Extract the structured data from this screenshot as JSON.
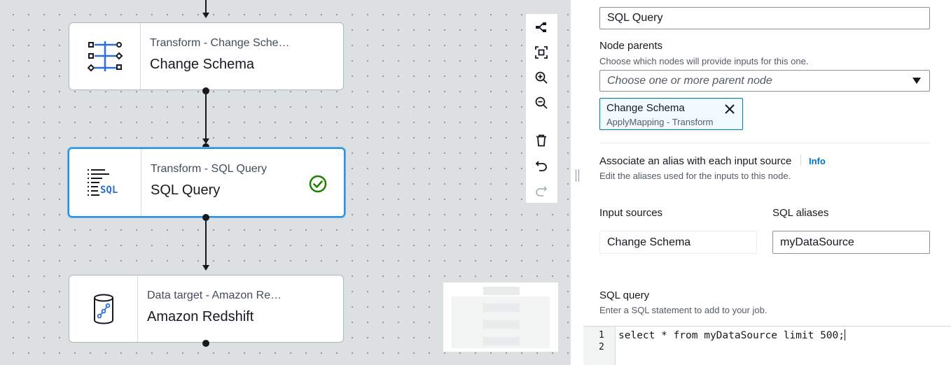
{
  "canvas": {
    "nodes": [
      {
        "type": "Transform - Change Sche…",
        "title": "Change Schema",
        "icon": "change-schema-icon",
        "selected": false
      },
      {
        "type": "Transform - SQL Query",
        "title": "SQL Query",
        "icon": "sql-query-icon",
        "selected": true,
        "status": "success-check-icon"
      },
      {
        "type": "Data target - Amazon Re…",
        "title": "Amazon Redshift",
        "icon": "redshift-icon",
        "selected": false
      }
    ],
    "icon_text": {
      "sql": "SQL"
    },
    "toolbar": [
      "layout-icon",
      "fit-to-screen-icon",
      "zoom-in-icon",
      "zoom-out-icon",
      "delete-icon",
      "undo-icon",
      "redo-icon"
    ]
  },
  "panel": {
    "name_value": "SQL Query",
    "node_parents": {
      "label": "Node parents",
      "description": "Choose which nodes will provide inputs for this one.",
      "placeholder": "Choose one or more parent node",
      "token": {
        "title": "Change Schema",
        "subtitle": "ApplyMapping - Transform"
      }
    },
    "alias": {
      "label": "Associate an alias with each input source",
      "info": "Info",
      "description": "Edit the aliases used for the inputs to this node."
    },
    "input_sources": {
      "label": "Input sources",
      "value": "Change Schema"
    },
    "sql_aliases": {
      "label": "SQL aliases",
      "value": "myDataSource"
    },
    "sql_query": {
      "label": "SQL query",
      "description": "Enter a SQL statement to add to your job.",
      "lines": [
        "1",
        "2"
      ],
      "code": "select * from myDataSource limit 500;"
    }
  },
  "colors": {
    "selected_border": "#2a93e0",
    "success": "#1d8102",
    "link": "#0073bb",
    "icon_blue": "#2f6edb"
  }
}
